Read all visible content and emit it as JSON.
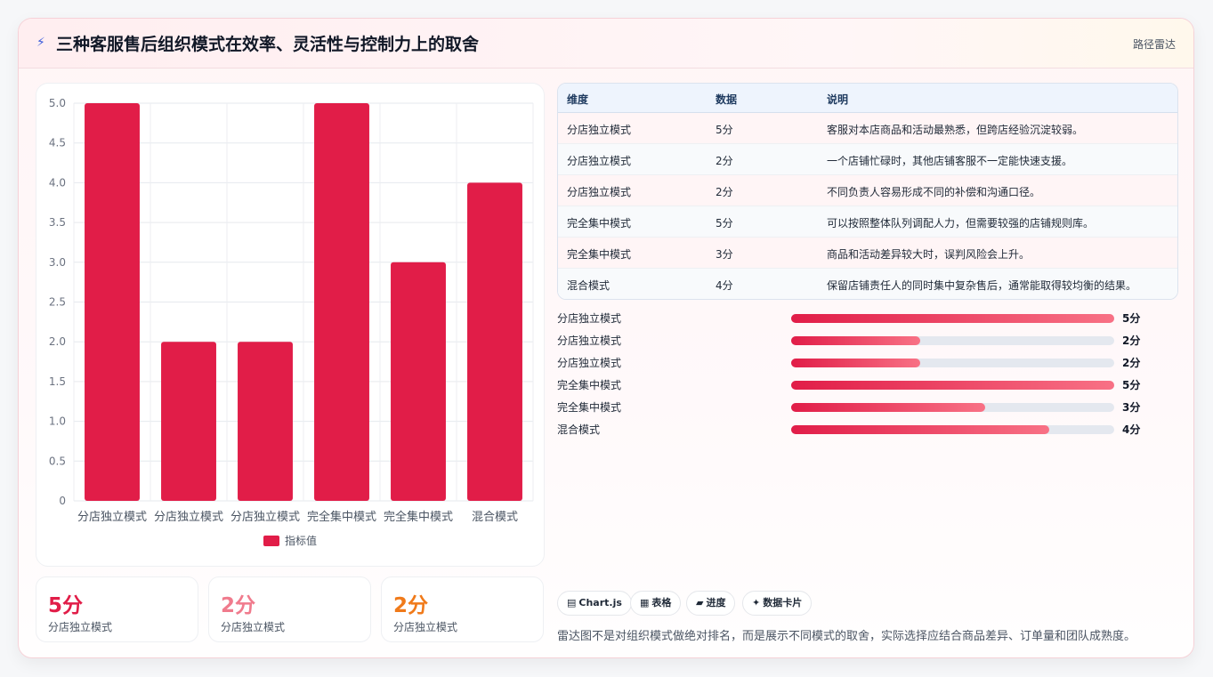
{
  "header": {
    "title": "三种客服售后组织模式在效率、灵活性与控制力上的取舍",
    "tag": "路径雷达"
  },
  "chart_data": {
    "type": "bar",
    "categories": [
      "分店独立模式",
      "分店独立模式",
      "分店独立模式",
      "完全集中模式",
      "完全集中模式",
      "混合模式"
    ],
    "series": [
      {
        "name": "指标值",
        "values": [
          5,
          2,
          2,
          5,
          3,
          4
        ]
      }
    ],
    "ylim": [
      0,
      5
    ],
    "yticks": [
      "5.0",
      "4.5",
      "4.0",
      "3.5",
      "3.0",
      "2.5",
      "2.0",
      "1.5",
      "1.0",
      "0.5",
      "0"
    ],
    "grid": true,
    "legend": "bottom",
    "color": "#e11d48"
  },
  "stats": [
    {
      "value": "5分",
      "label": "分店独立模式",
      "color": "#e11d48"
    },
    {
      "value": "2分",
      "label": "分店独立模式",
      "color": "#f07b8d"
    },
    {
      "value": "2分",
      "label": "分店独立模式",
      "color": "#f07a1a"
    }
  ],
  "table": {
    "headers": [
      "维度",
      "数据",
      "说明"
    ],
    "rows": [
      {
        "dim": "分店独立模式",
        "data": "5分",
        "desc": "客服对本店商品和活动最熟悉，但跨店经验沉淀较弱。"
      },
      {
        "dim": "分店独立模式",
        "data": "2分",
        "desc": "一个店铺忙碌时，其他店铺客服不一定能快速支援。"
      },
      {
        "dim": "分店独立模式",
        "data": "2分",
        "desc": "不同负责人容易形成不同的补偿和沟通口径。"
      },
      {
        "dim": "完全集中模式",
        "data": "5分",
        "desc": "可以按照整体队列调配人力，但需要较强的店铺规则库。"
      },
      {
        "dim": "完全集中模式",
        "data": "3分",
        "desc": "商品和活动差异较大时，误判风险会上升。"
      },
      {
        "dim": "混合模式",
        "data": "4分",
        "desc": "保留店铺责任人的同时集中复杂售后，通常能取得较均衡的结果。"
      }
    ]
  },
  "progress": {
    "max": 5,
    "items": [
      {
        "label": "分店独立模式",
        "value": 5,
        "text": "5分"
      },
      {
        "label": "分店独立模式",
        "value": 2,
        "text": "2分"
      },
      {
        "label": "分店独立模式",
        "value": 2,
        "text": "2分"
      },
      {
        "label": "完全集中模式",
        "value": 5,
        "text": "5分"
      },
      {
        "label": "完全集中模式",
        "value": 3,
        "text": "3分"
      },
      {
        "label": "混合模式",
        "value": 4,
        "text": "4分"
      }
    ]
  },
  "chips": [
    {
      "icon": "▤",
      "icon_name": "chart-icon",
      "label": "Chart.js"
    },
    {
      "icon": "▦",
      "icon_name": "table-icon",
      "label": "表格"
    },
    {
      "icon": "▰",
      "icon_name": "progress-icon",
      "label": "进度"
    },
    {
      "icon": "✦",
      "icon_name": "sparkle-icon",
      "label": "数据卡片"
    }
  ],
  "note": "雷达图不是对组织模式做绝对排名，而是展示不同模式的取舍，实际选择应结合商品差异、订单量和团队成熟度。"
}
